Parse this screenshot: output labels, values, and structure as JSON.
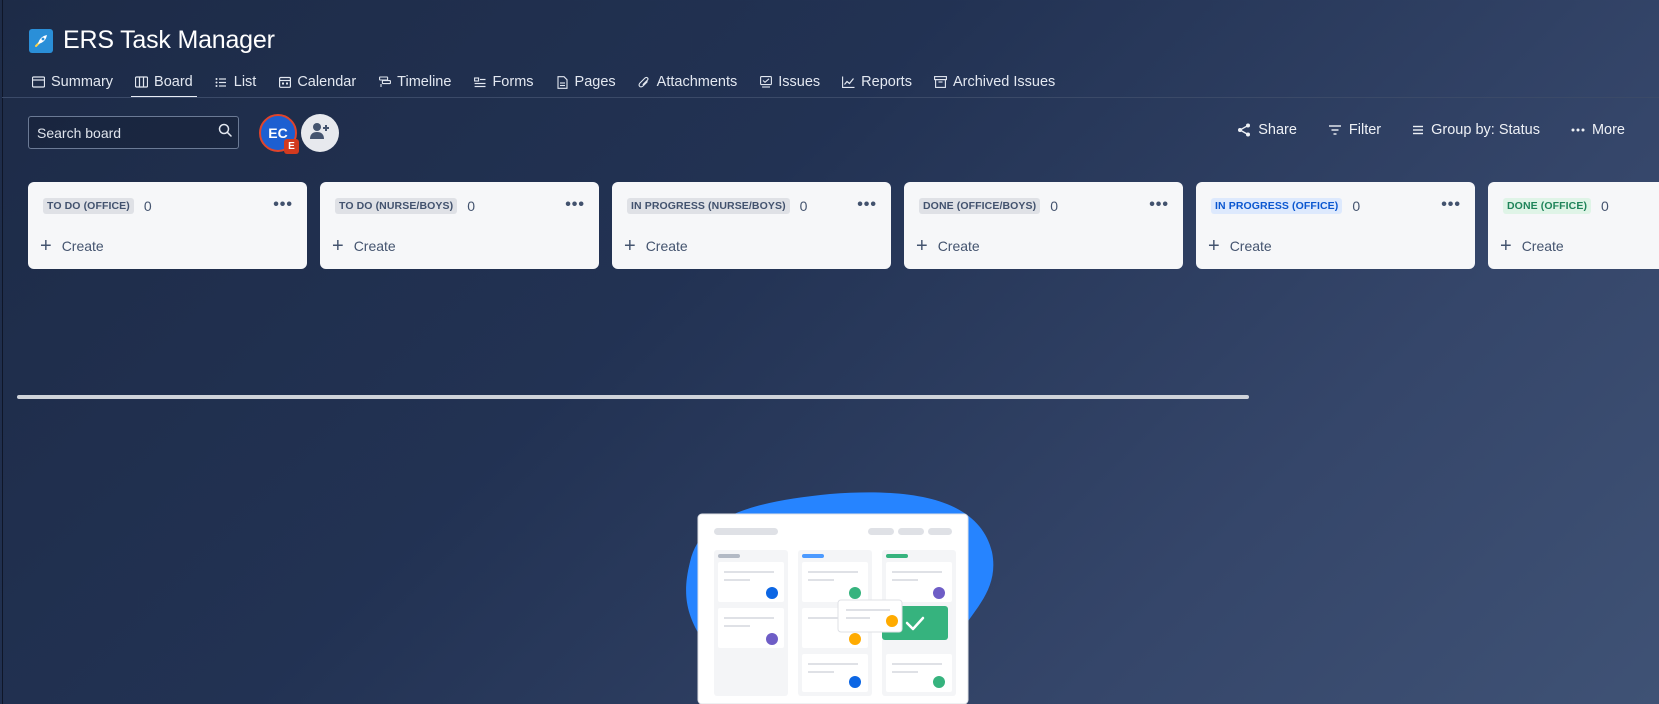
{
  "project": {
    "title": "ERS Task Manager",
    "icon": "rocket-icon"
  },
  "tabs": [
    {
      "label": "Summary",
      "icon": "summary-icon"
    },
    {
      "label": "Board",
      "icon": "board-icon",
      "active": true
    },
    {
      "label": "List",
      "icon": "list-icon"
    },
    {
      "label": "Calendar",
      "icon": "calendar-icon"
    },
    {
      "label": "Timeline",
      "icon": "timeline-icon"
    },
    {
      "label": "Forms",
      "icon": "forms-icon"
    },
    {
      "label": "Pages",
      "icon": "pages-icon"
    },
    {
      "label": "Attachments",
      "icon": "attachment-icon"
    },
    {
      "label": "Issues",
      "icon": "issues-icon"
    },
    {
      "label": "Reports",
      "icon": "reports-icon"
    },
    {
      "label": "Archived Issues",
      "icon": "archive-icon"
    }
  ],
  "search": {
    "placeholder": "Search board"
  },
  "avatar": {
    "initials": "EC",
    "badge": "E"
  },
  "toolbar": {
    "share": "Share",
    "filter": "Filter",
    "group_by": "Group by: Status",
    "more": "More"
  },
  "columns": [
    {
      "status": "TO DO (OFFICE)",
      "count": "0",
      "style": "default",
      "create": "Create"
    },
    {
      "status": "TO DO (NURSE/BOYS)",
      "count": "0",
      "style": "default",
      "create": "Create"
    },
    {
      "status": "IN PROGRESS (NURSE/BOYS)",
      "count": "0",
      "style": "default",
      "create": "Create"
    },
    {
      "status": "DONE (OFFICE/BOYS)",
      "count": "0",
      "style": "default",
      "create": "Create"
    },
    {
      "status": "IN PROGRESS (OFFICE)",
      "count": "0",
      "style": "inprogress",
      "create": "Create"
    },
    {
      "status": "DONE (OFFICE)",
      "count": "0",
      "style": "done",
      "create": "Create"
    }
  ],
  "colors": {
    "in_progress": "#0b57d0",
    "done": "#1f845a",
    "illustration_blob": "#2684ff"
  }
}
